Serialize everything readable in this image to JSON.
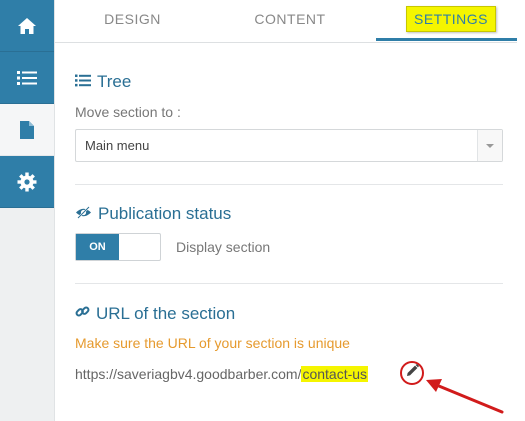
{
  "sidebar": {
    "items": [
      {
        "icon": "home-icon"
      },
      {
        "icon": "list-icon"
      },
      {
        "icon": "document-icon",
        "active": true
      },
      {
        "icon": "gear-icon"
      }
    ]
  },
  "tabs": [
    {
      "label": "DESIGN"
    },
    {
      "label": "CONTENT"
    },
    {
      "label": "SETTINGS",
      "active": true
    }
  ],
  "tree": {
    "title": "Tree",
    "move_label": "Move section to :",
    "select_value": "Main menu"
  },
  "publication": {
    "title": "Publication status",
    "toggle_on": "ON",
    "toggle_state": "on",
    "toggle_label": "Display section"
  },
  "url_section": {
    "title": "URL of the section",
    "hint": "Make sure the URL of your section is unique",
    "url_prefix": "https://saveriagbv4.goodbarber.com/",
    "url_slug": "contact-us"
  },
  "colors": {
    "accent": "#2f7ea8",
    "highlight": "#f5f500",
    "warning_text": "#e69a2e",
    "annotation_red": "#d11b1b"
  }
}
